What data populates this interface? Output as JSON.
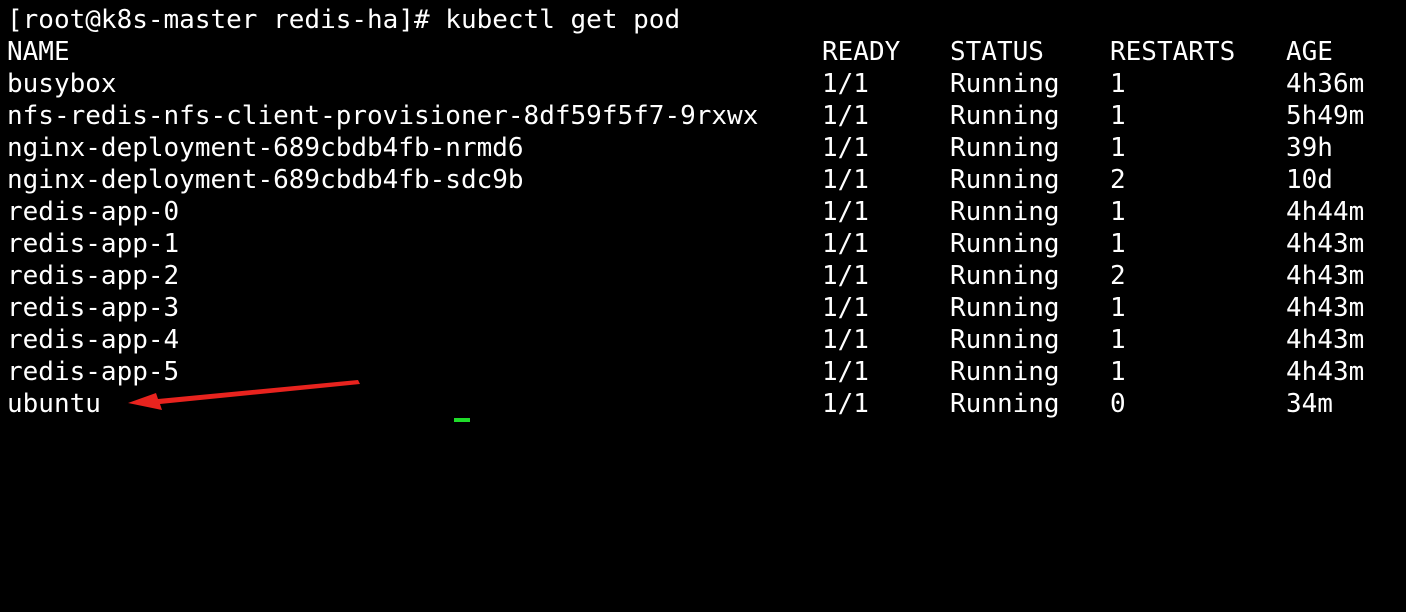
{
  "terminal": {
    "prompt": "[root@k8s-master redis-ha]# kubectl get pod",
    "colors": {
      "background": "#000000",
      "text": "#ffffff",
      "cursor": "#1fdc2a",
      "annotation_arrow": "#e8231e"
    },
    "table": {
      "headers": {
        "name": "NAME",
        "ready": "READY",
        "status": "STATUS",
        "restarts": "RESTARTS",
        "age": "AGE"
      },
      "rows": [
        {
          "name": "busybox",
          "ready": "1/1",
          "status": "Running",
          "restarts": "1",
          "age": "4h36m"
        },
        {
          "name": "nfs-redis-nfs-client-provisioner-8df59f5f7-9rxwx",
          "ready": "1/1",
          "status": "Running",
          "restarts": "1",
          "age": "5h49m"
        },
        {
          "name": "nginx-deployment-689cbdb4fb-nrmd6",
          "ready": "1/1",
          "status": "Running",
          "restarts": "1",
          "age": "39h"
        },
        {
          "name": "nginx-deployment-689cbdb4fb-sdc9b",
          "ready": "1/1",
          "status": "Running",
          "restarts": "2",
          "age": "10d"
        },
        {
          "name": "redis-app-0",
          "ready": "1/1",
          "status": "Running",
          "restarts": "1",
          "age": "4h44m"
        },
        {
          "name": "redis-app-1",
          "ready": "1/1",
          "status": "Running",
          "restarts": "1",
          "age": "4h43m"
        },
        {
          "name": "redis-app-2",
          "ready": "1/1",
          "status": "Running",
          "restarts": "2",
          "age": "4h43m"
        },
        {
          "name": "redis-app-3",
          "ready": "1/1",
          "status": "Running",
          "restarts": "1",
          "age": "4h43m"
        },
        {
          "name": "redis-app-4",
          "ready": "1/1",
          "status": "Running",
          "restarts": "1",
          "age": "4h43m"
        },
        {
          "name": "redis-app-5",
          "ready": "1/1",
          "status": "Running",
          "restarts": "1",
          "age": "4h43m"
        },
        {
          "name": "ubuntu",
          "ready": "1/1",
          "status": "Running",
          "restarts": "0",
          "age": "34m"
        }
      ]
    },
    "annotation": {
      "icon": "arrow-pointer-icon",
      "points_to_row": "ubuntu"
    }
  }
}
